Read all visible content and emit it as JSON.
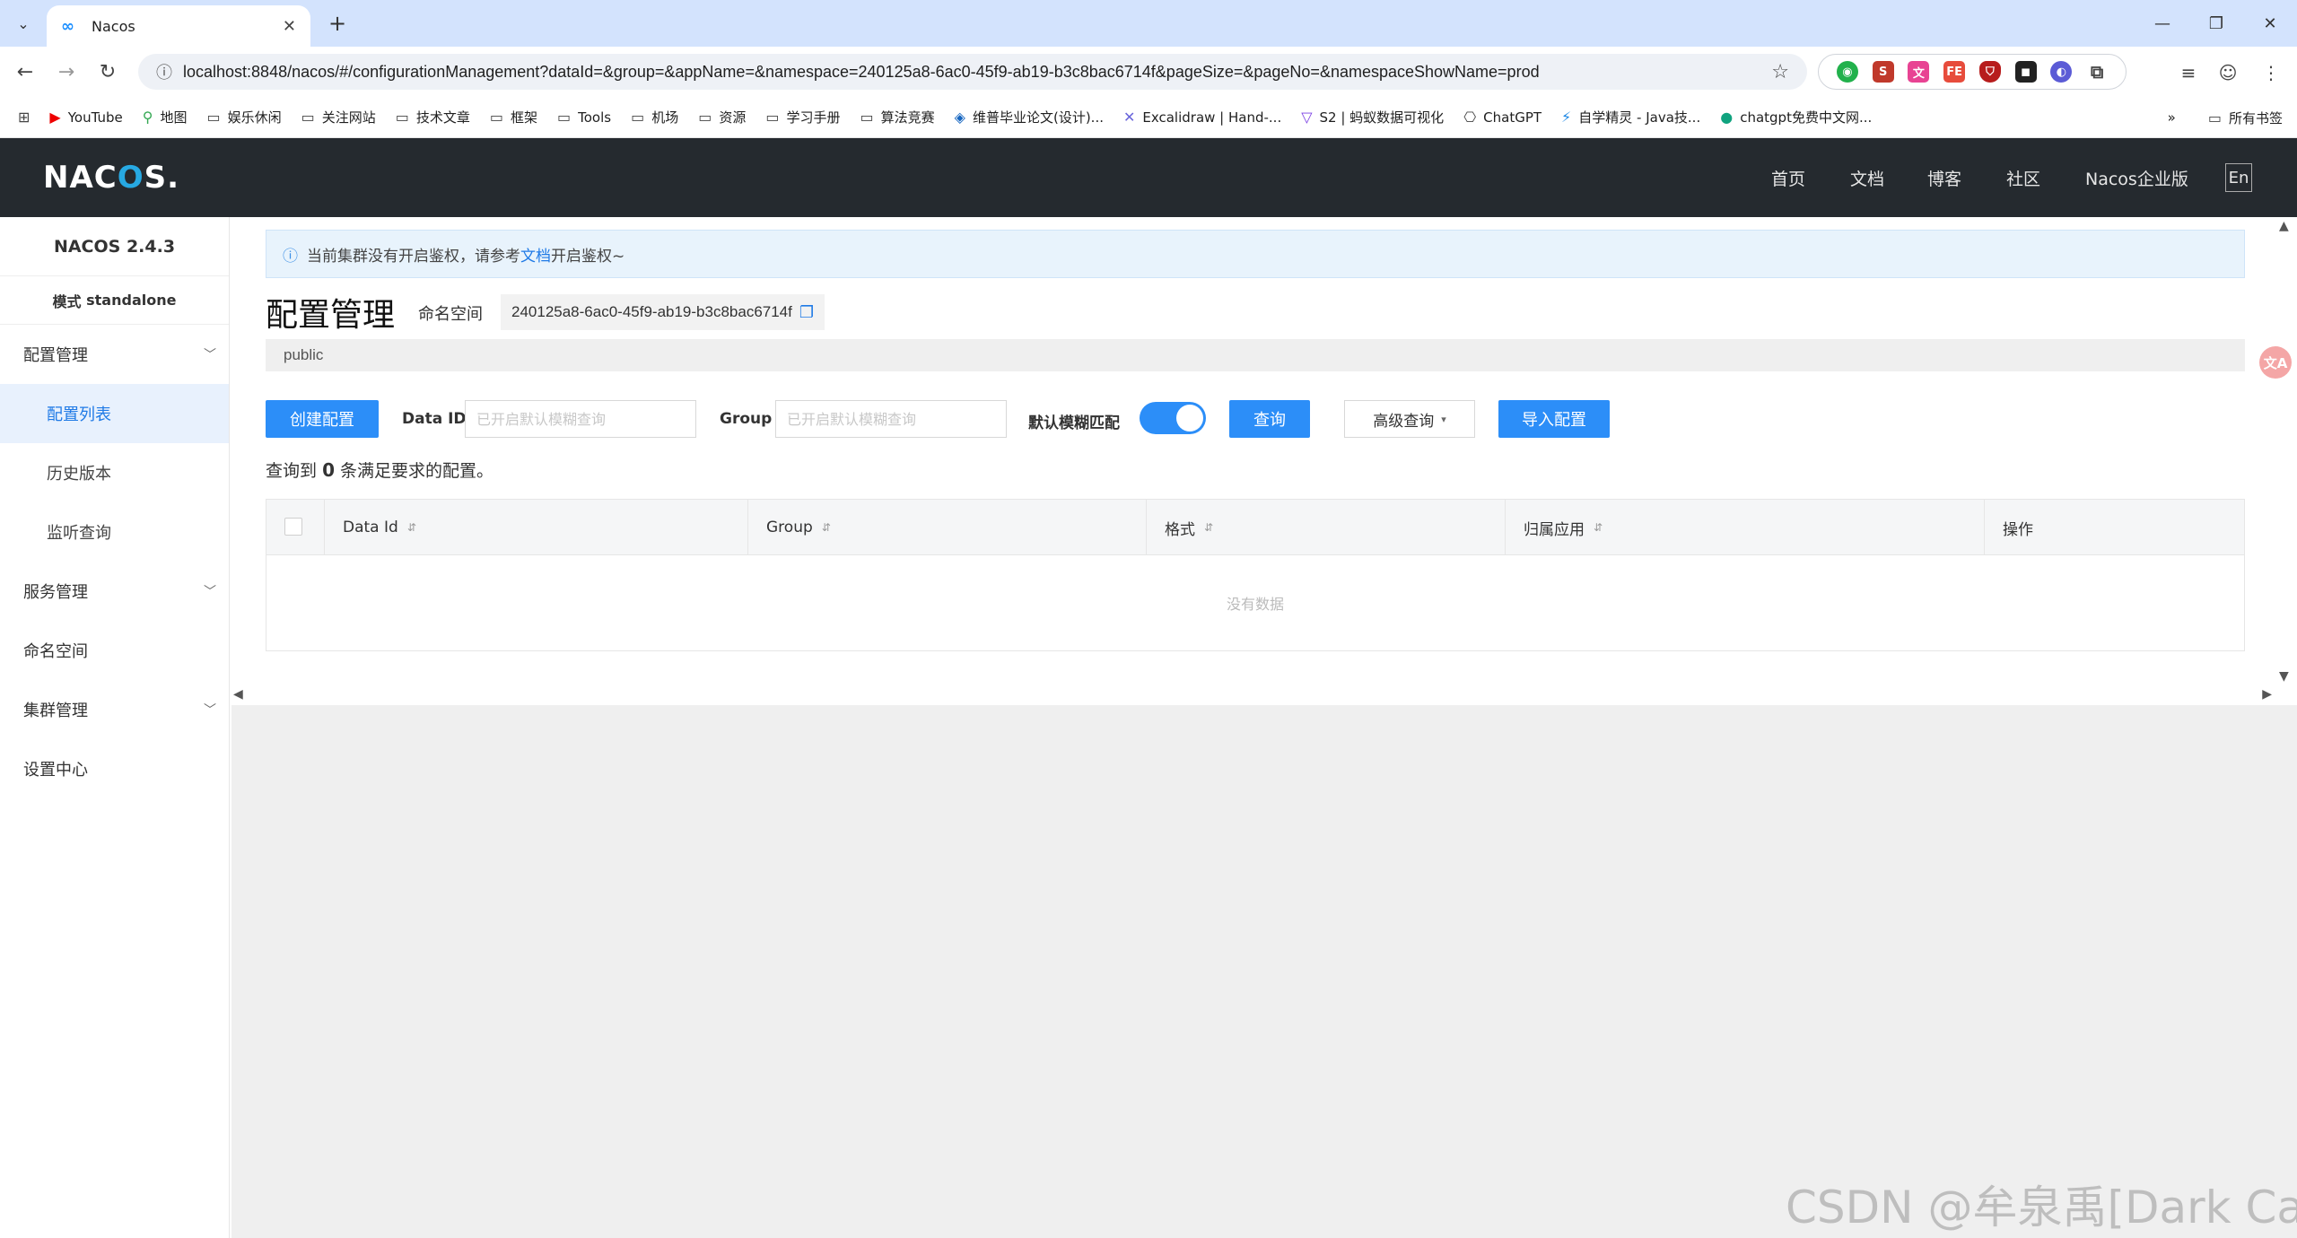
{
  "browser": {
    "tab_title": "Nacos",
    "url": "localhost:8848/nacos/#/configurationManagement?dataId=&group=&appName=&namespace=240125a8-6ac0-45f9-ab19-b3c8bac6714f&pageSize=&pageNo=&namespaceShowName=prod",
    "bookmarks": [
      {
        "label": "YouTube"
      },
      {
        "label": "地图"
      },
      {
        "label": "娱乐休闲"
      },
      {
        "label": "关注网站"
      },
      {
        "label": "技术文章"
      },
      {
        "label": "框架"
      },
      {
        "label": "Tools"
      },
      {
        "label": "机场"
      },
      {
        "label": "资源"
      },
      {
        "label": "学习手册"
      },
      {
        "label": "算法竞赛"
      },
      {
        "label": "维普毕业论文(设计)..."
      },
      {
        "label": "Excalidraw | Hand-..."
      },
      {
        "label": "S2 | 蚂蚁数据可视化"
      },
      {
        "label": "ChatGPT"
      },
      {
        "label": "自学精灵 - Java技..."
      },
      {
        "label": "chatgpt免费中文网..."
      }
    ],
    "bookmarks_more": "»",
    "all_bookmarks": "所有书签"
  },
  "header": {
    "logo_a": "NAC",
    "logo_o": "O",
    "logo_b": "S.",
    "nav": [
      "首页",
      "文档",
      "博客",
      "社区",
      "Nacos企业版"
    ],
    "lang": "En"
  },
  "sidebar": {
    "version": "NACOS 2.4.3",
    "mode_label": "模式",
    "mode_value": "standalone",
    "config_mgmt": "配置管理",
    "config_list": "配置列表",
    "history": "历史版本",
    "listen_query": "监听查询",
    "service_mgmt": "服务管理",
    "namespace": "命名空间",
    "cluster_mgmt": "集群管理",
    "settings": "设置中心"
  },
  "notice": {
    "before": "当前集群没有开启鉴权，请参考",
    "link": "文档",
    "after": "开启鉴权~"
  },
  "page": {
    "title": "配置管理",
    "namespace_label": "命名空间",
    "namespace_id": "240125a8-6ac0-45f9-ab19-b3c8bac6714f",
    "namespace_tab": "public"
  },
  "toolbar": {
    "create": "创建配置",
    "dataid_label": "Data ID",
    "dataid_placeholder": "已开启默认模糊查询",
    "group_label": "Group",
    "group_placeholder": "已开启默认模糊查询",
    "fuzzy_label": "默认模糊匹配",
    "fuzzy_on": true,
    "search": "查询",
    "advanced": "高级查询",
    "import": "导入配置"
  },
  "result": {
    "prefix": "查询到",
    "count": "0",
    "suffix": "条满足要求的配置。"
  },
  "table": {
    "columns": [
      "Data Id",
      "Group",
      "格式",
      "归属应用",
      "操作"
    ],
    "empty": "没有数据"
  },
  "watermark": "CSDN @牟泉禹[Dark Cat]",
  "colors": {
    "primary": "#2c8ef8",
    "header_bg": "#252a2f",
    "notice_bg": "#e8f3fc"
  }
}
